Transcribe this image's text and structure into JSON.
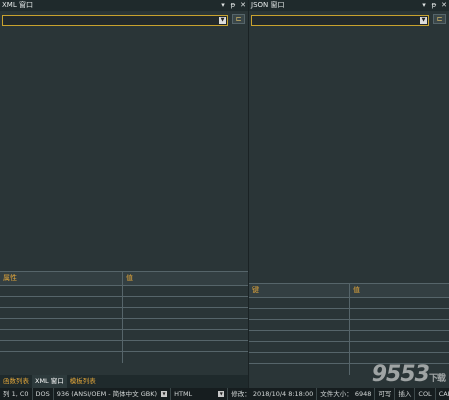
{
  "xml_panel": {
    "title": "XML 窗口",
    "grid": {
      "col1": "属性",
      "col2": "值"
    },
    "tabs": [
      "函数列表",
      "XML 窗口",
      "模板列表"
    ]
  },
  "json_panel": {
    "title": "JSON 窗口",
    "grid": {
      "col1": "键",
      "col2": "值"
    }
  },
  "title_buttons": {
    "pin_down": "▾",
    "pin": "ꟷ",
    "close": "✕"
  },
  "statusbar": {
    "position": "列 1, C0",
    "line_ending": "DOS",
    "codepage": "936",
    "encoding": "(ANSI/OEM - 简体中文 GBK)",
    "syntax": "HTML",
    "modified": "修改： 2018/10/4 8:18:00",
    "filesize": "文件大小： 6948",
    "rw": "可写",
    "insert": "插入",
    "col": "COL",
    "cap": "CAP"
  },
  "watermark": {
    "main": "9553",
    "sub": "下载"
  },
  "colors": {
    "accent": "#e0a53a",
    "combo_border": "#c8a22e",
    "panel_bg": "#2a3537"
  }
}
